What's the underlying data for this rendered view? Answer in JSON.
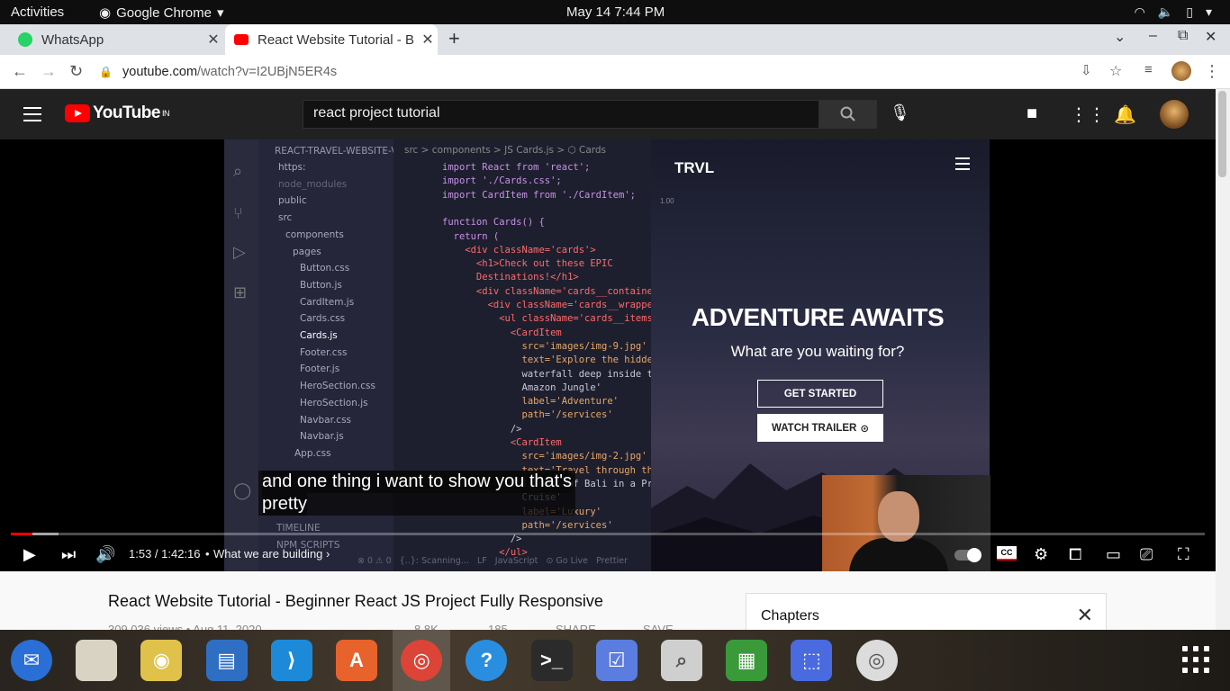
{
  "system_bar": {
    "activities": "Activities",
    "app_name": "Google Chrome",
    "datetime": "May 14  7:44 PM"
  },
  "browser": {
    "tabs": [
      {
        "title": "WhatsApp",
        "favicon": "whatsapp-icon"
      },
      {
        "title": "React Website Tutorial - B",
        "favicon": "youtube-icon"
      }
    ],
    "url_host": "youtube.com",
    "url_path": "/watch?v=I2UBjN5ER4s"
  },
  "youtube": {
    "logo_text": "YouTube",
    "region": "IN",
    "search_query": "react project tutorial"
  },
  "video": {
    "explorer": {
      "root": "REACT-TRAVEL-WEBSITE-V1",
      "items": [
        "https:",
        "node_modules",
        "public",
        "src",
        "components",
        "pages",
        "Button.css",
        "Button.js",
        "CardItem.js",
        "Cards.css",
        "Cards.js",
        "Footer.css",
        "Footer.js",
        "HeroSection.css",
        "HeroSection.js",
        "Navbar.css",
        "Navbar.js",
        "App.css"
      ],
      "bottom": [
        "TIMELINE",
        "NPM SCRIPTS"
      ]
    },
    "editor": {
      "breadcrumb": "src > components > JS Cards.js > ⬡ Cards",
      "lines": [
        "import React from 'react';",
        "import './Cards.css';",
        "import CardItem from './CardItem';",
        "",
        "function Cards() {",
        "  return (",
        "    <div className='cards'>",
        "      <h1>Check out these EPIC",
        "      Destinations!</h1>",
        "      <div className='cards__containe",
        "        <div className='cards__wrapper",
        "          <ul className='cards__items'",
        "            <CardItem",
        "              src='images/img-9.jpg'",
        "              text='Explore the hidden",
        "              waterfall deep inside th",
        "              Amazon Jungle'",
        "              label='Adventure'",
        "              path='/services'",
        "            />",
        "            <CardItem",
        "              src='images/img-2.jpg'",
        "              text='Travel through the",
        "              Islands of Bali in a Pri",
        "              Cruise'",
        "              label='Luxury'",
        "              path='/services'",
        "            />",
        "          </ul>"
      ],
      "status": "⊗ 0 ⚠ 0   {..}: Scanning...   LF   JavaScript   ⊙ Go Live   Prettier"
    },
    "site": {
      "logo": "TRVL",
      "zoom": "1.00",
      "hero_title": "ADVENTURE AWAITS",
      "hero_subtitle": "What are you waiting for?",
      "btn_primary": "GET STARTED",
      "btn_secondary": "WATCH TRAILER"
    },
    "caption_line1": "and one thing i want to show you that's",
    "caption_line2": "pretty",
    "progress_fraction": 0.018,
    "buffered_fraction": 0.04,
    "time": "1:53 / 1:42:16",
    "separator": "•",
    "chapter": "What we are building",
    "cc_label": "CC"
  },
  "page": {
    "title": "React Website Tutorial - Beginner React JS Project Fully Responsive",
    "meta": "309,036 views • Aug 11, 2020",
    "actions": [
      "8.8K",
      "185",
      "SHARE",
      "SAVE"
    ],
    "chapters_label": "Chapters"
  },
  "dock": {
    "apps": [
      "thunderbird-icon",
      "files-icon",
      "rhythmbox-icon",
      "writer-icon",
      "vscode-icon",
      "software-icon",
      "chrome-icon",
      "help-icon",
      "terminal-icon",
      "tasks-icon",
      "image-viewer-icon",
      "calc-icon",
      "screenshot-icon",
      "disc-icon"
    ]
  },
  "colors": {
    "youtube_red": "#ff0000",
    "yt_dark": "#212121",
    "chrome_tabstrip": "#dee1e6"
  }
}
